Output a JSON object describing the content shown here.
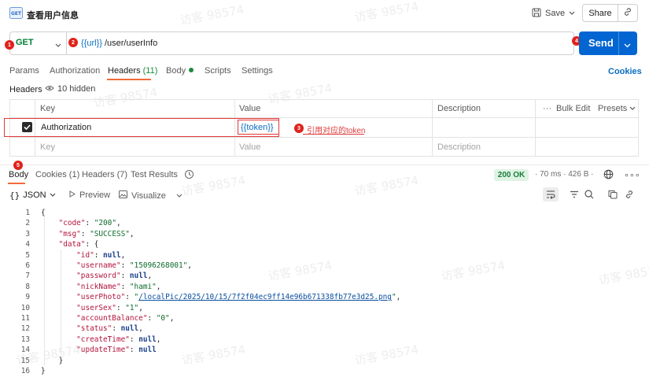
{
  "topbar": {
    "request_title": "查看用户信息",
    "save_label": "Save",
    "share_label": "Share"
  },
  "request": {
    "method": "GET",
    "url_variable": "{{url}}",
    "url_path": " /user/userInfo",
    "send_label": "Send"
  },
  "annotations": [
    "1",
    "2",
    "3",
    "4",
    "5"
  ],
  "annotation_note": "引用对应的token",
  "request_tabs": {
    "params": "Params",
    "authorization": "Authorization",
    "headers": "Headers",
    "headers_count": "(11)",
    "body": "Body",
    "scripts": "Scripts",
    "settings": "Settings",
    "cookies": "Cookies"
  },
  "headers_section": {
    "label": "Headers",
    "hidden_label": "10 hidden",
    "columns": {
      "key": "Key",
      "value": "Value",
      "description": "Description"
    },
    "bulk_edit": "Bulk Edit",
    "presets": "Presets",
    "rows": [
      {
        "key": "Authorization",
        "value": "{{token}}",
        "enabled": true
      }
    ],
    "placeholder": {
      "key": "Key",
      "value": "Value",
      "description": "Description"
    }
  },
  "response_tabs": {
    "body": "Body",
    "cookies": "Cookies (1)",
    "headers": "Headers (7)",
    "test_results": "Test Results"
  },
  "response_meta": {
    "status": "200 OK",
    "time": "70 ms",
    "size": "426 B"
  },
  "format_bar": {
    "format": "JSON",
    "preview": "Preview",
    "visualize": "Visualize"
  },
  "code_lines": [
    "1",
    "2",
    "3",
    "4",
    "5",
    "6",
    "7",
    "8",
    "9",
    "10",
    "11",
    "12",
    "13",
    "14",
    "15",
    "16"
  ],
  "response_json": {
    "code": "\"200\"",
    "msg": "\"SUCCESS\"",
    "id": "null",
    "username": "\"15096268001\"",
    "password": "null",
    "nickName": "\"hami\"",
    "userPhoto": "/localPic/2025/10/15/7f2f04ec9ff14e96b671338fb77e3d25.png",
    "userSex": "\"1\"",
    "accountBalance": "\"0\"",
    "status": "null",
    "createTime": "null",
    "updateTime": "null"
  },
  "watermark": "访客 98574",
  "colors": {
    "accent": "#f26b3a",
    "send": "#0265d2",
    "method": "#007f31",
    "annotation": "#e03a3a"
  }
}
